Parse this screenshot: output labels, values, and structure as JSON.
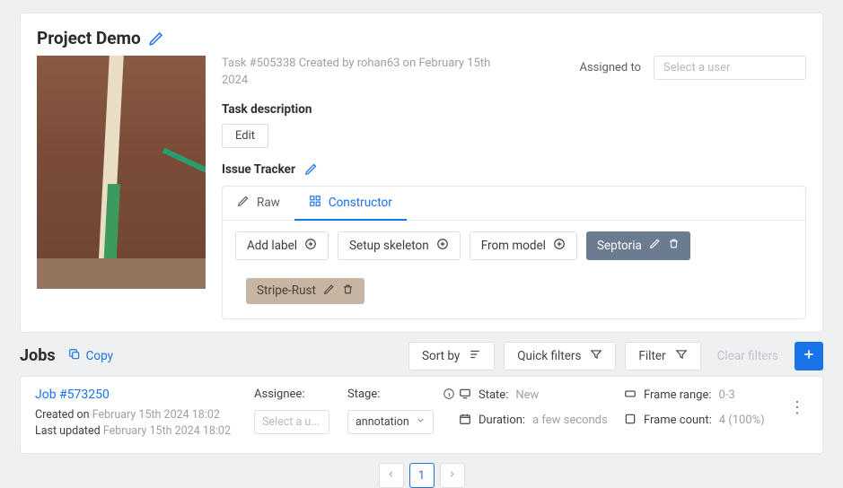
{
  "project": {
    "title": "Project Demo",
    "task_meta": "Task #505338 Created by rohan63 on February 15th 2024",
    "assigned_label": "Assigned to",
    "assigned_placeholder": "Select a user",
    "description_label": "Task description",
    "edit_label": "Edit",
    "issue_label": "Issue Tracker"
  },
  "tabs": {
    "raw": "Raw",
    "constructor": "Constructor"
  },
  "label_actions": {
    "add": "Add label",
    "skeleton": "Setup skeleton",
    "model": "From model"
  },
  "labels": [
    {
      "name": "Septoria",
      "color": "#6b7c91",
      "text_color": "#ffffff"
    },
    {
      "name": "Stripe-Rust",
      "color": "#c7b5a3",
      "text_color": "#4a4138"
    }
  ],
  "jobs_header": {
    "title": "Jobs",
    "copy": "Copy",
    "sort": "Sort by",
    "quick": "Quick filters",
    "filter": "Filter",
    "clear": "Clear filters"
  },
  "job": {
    "link": "Job #573250",
    "created_label": "Created on",
    "created_value": "February 15th 2024 18:02",
    "updated_label": "Last updated",
    "updated_value": "February 15th 2024 18:02",
    "assignee_label": "Assignee:",
    "assignee_placeholder": "Select a u...",
    "stage_label": "Stage:",
    "stage_value": "annotation",
    "state_label": "State:",
    "state_value": "New",
    "duration_label": "Duration:",
    "duration_value": "a few seconds",
    "frame_range_label": "Frame range:",
    "frame_range_value": "0-3",
    "frame_count_label": "Frame count:",
    "frame_count_value": "4 (100%)"
  },
  "pager": {
    "current": "1"
  }
}
